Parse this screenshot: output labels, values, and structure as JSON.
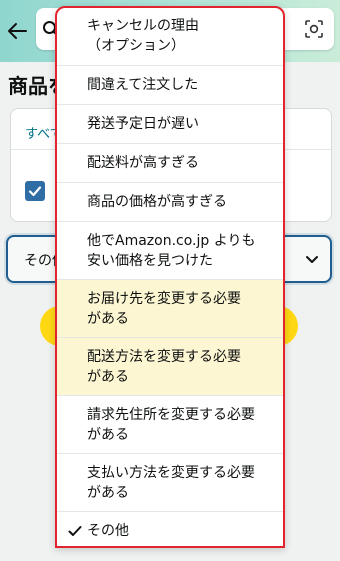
{
  "header": {
    "back_icon": "arrow-left-icon",
    "search_icon": "search-icon",
    "camera_icon": "camera-scan-icon"
  },
  "page": {
    "title": "商品を",
    "card_link": "すべて",
    "checkbox_checked": true,
    "select_value": "その他",
    "chevron_icon": "chevron-down-icon"
  },
  "dropdown": {
    "options": [
      {
        "label": "キャンセルの理由\n（オプション）"
      },
      {
        "label": "間違えて注文した"
      },
      {
        "label": "発送予定日が遅い"
      },
      {
        "label": "配送料が高すぎる"
      },
      {
        "label": "商品の価格が高すぎる"
      },
      {
        "label": "他でAmazon.co.jp よりも\n安い価格を見つけた"
      },
      {
        "label": "お届け先を変更する必要\nがある"
      },
      {
        "label": "配送方法を変更する必要\nがある"
      },
      {
        "label": "請求先住所を変更する必要\nがある"
      },
      {
        "label": "支払い方法を変更する必要\nがある"
      },
      {
        "label": "その他",
        "selected": true
      }
    ],
    "check_icon": "checkmark-icon"
  },
  "colors": {
    "header_gradient_start": "#8fd6cf",
    "header_gradient_end": "#c9ecd8",
    "link": "#007185",
    "checkbox": "#2f6ea5",
    "select_border": "#1f5e8e",
    "primary_button": "#ffd814",
    "highlight_row": "#fdf6d3",
    "red_outline": "#e2242f"
  }
}
